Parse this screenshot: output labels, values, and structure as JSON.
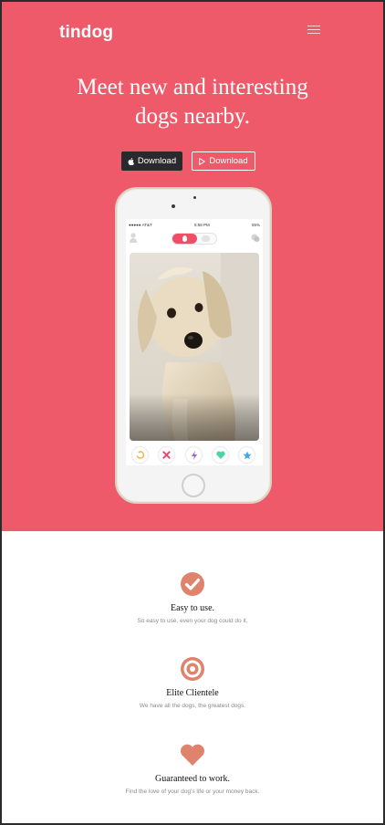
{
  "brand": "tindog",
  "hero": {
    "headline_line1": "Meet new and interesting",
    "headline_line2": "dogs nearby.",
    "download_apple_label": "Download",
    "download_play_label": "Download"
  },
  "phone": {
    "status_carrier": "●●●●● AT&T",
    "status_time": "5:58 PM",
    "status_battery": "55%"
  },
  "features": [
    {
      "icon": "check-circle-icon",
      "title": "Easy to use.",
      "description": "So easy to use, even your dog could do it."
    },
    {
      "icon": "bullseye-icon",
      "title": "Elite Clientele",
      "description": "We have all the dogs, the greatest dogs."
    },
    {
      "icon": "heart-icon",
      "title": "Guaranteed to work.",
      "description": "Find the love of your dog's life or your money back."
    }
  ],
  "colors": {
    "hero_background": "#ef5a6a",
    "icon_accent": "#e0836d",
    "dark_button": "#2a2a2e"
  }
}
